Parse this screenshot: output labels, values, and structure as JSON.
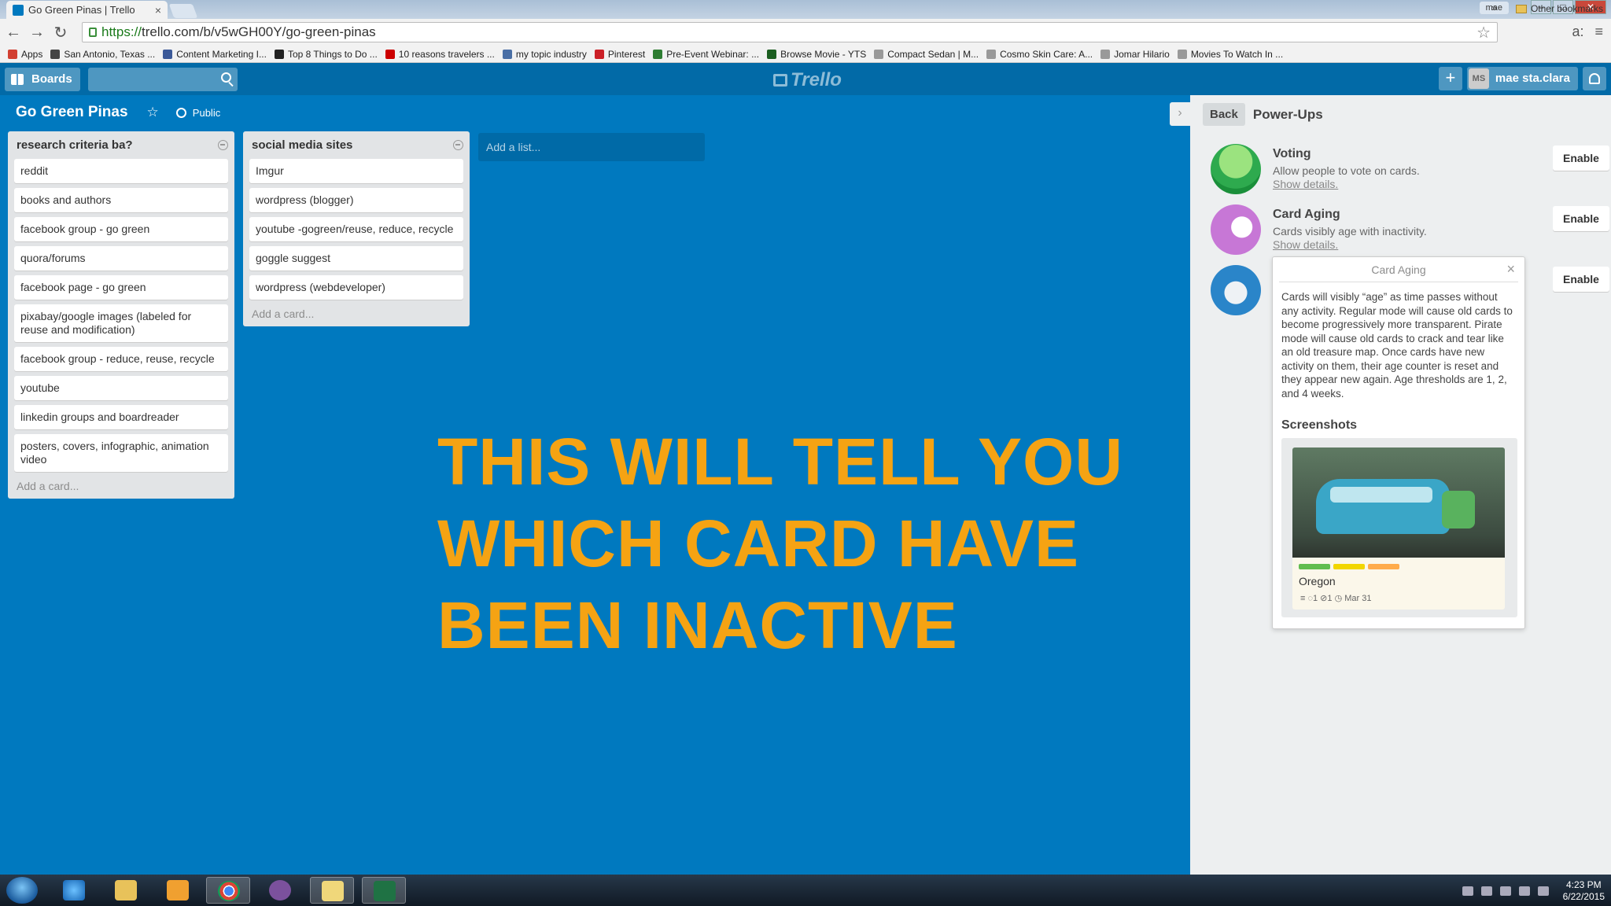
{
  "browser": {
    "tab_title": "Go Green Pinas | Trello",
    "tab_close": "×",
    "window_user": "mae",
    "url_https": "https://",
    "url_path": "trello.com/b/v5wGH00Y/go-green-pinas",
    "bookmarks": [
      {
        "label": "Apps",
        "color": "#d23f31"
      },
      {
        "label": "San Antonio, Texas ...",
        "color": "#444444"
      },
      {
        "label": "Content Marketing I...",
        "color": "#3b5998"
      },
      {
        "label": "Top 8 Things to Do ...",
        "color": "#222222"
      },
      {
        "label": "10 reasons travelers ...",
        "color": "#cc0000"
      },
      {
        "label": "my topic industry",
        "color": "#4a6fa5"
      },
      {
        "label": "Pinterest",
        "color": "#cb2027"
      },
      {
        "label": "Pre-Event Webinar: ...",
        "color": "#2e7d32"
      },
      {
        "label": "Browse Movie - YTS",
        "color": "#1b5e20"
      },
      {
        "label": "Compact Sedan | M...",
        "color": "#999999"
      },
      {
        "label": "Cosmo Skin Care: A...",
        "color": "#999999"
      },
      {
        "label": "Jomar Hilario",
        "color": "#999999"
      },
      {
        "label": "Movies To Watch In ...",
        "color": "#999999"
      }
    ],
    "bookmarks_more": "»",
    "other_bookmarks": "Other bookmarks"
  },
  "header": {
    "boards_label": "Boards",
    "logo_text": "Trello",
    "add_label": "+",
    "user_initials": "MS",
    "user_name": "mae sta.clara"
  },
  "board": {
    "title": "Go Green Pinas",
    "star": "☆",
    "visibility": "Public"
  },
  "lists": [
    {
      "title": "research criteria ba?",
      "cards": [
        "reddit",
        "books and authors",
        "facebook group - go green",
        "quora/forums",
        "facebook page - go green",
        "pixabay/google images (labeled for reuse and modification)",
        "facebook group - reduce, reuse, recycle",
        "youtube",
        "linkedin groups and boardreader",
        "posters, covers, infographic, animation video"
      ],
      "add_card": "Add a card..."
    },
    {
      "title": "social media sites",
      "cards": [
        "Imgur",
        "wordpress (blogger)",
        "youtube -gogreen/reuse, reduce, recycle",
        "goggle suggest",
        "wordpress (webdeveloper)"
      ],
      "add_card": "Add a card..."
    }
  ],
  "add_list": "Add a list...",
  "caption": "THIS WILL TELL YOU WHICH CARD HAVE BEEN INACTIVE",
  "sidebar": {
    "toggle": "›",
    "back": "Back",
    "title": "Power-Ups",
    "powerups": [
      {
        "name": "Voting",
        "desc": "Allow people to vote on cards.",
        "link": "Show details.",
        "button": "Enable"
      },
      {
        "name": "Card Aging",
        "desc": "Cards visibly age with inactivity.",
        "link": "Show details.",
        "button": "Enable"
      },
      {
        "button": "Enable"
      }
    ]
  },
  "popover": {
    "title": "Card Aging",
    "close": "×",
    "body": "Cards will visibly “age” as time passes without any activity. Regular mode will cause old cards to become progressively more transparent. Pirate mode will cause old cards to crack and tear like an old treasure map. Once cards have new activity on them, their age counter is reset and they appear new again. Age thresholds are 1, 2, and 4 weeks.",
    "screenshots_label": "Screenshots",
    "sample_card": {
      "title": "Oregon",
      "badges": "≡  ◌1  ⊘1  ◷ Mar 31",
      "label_colors": [
        "#61bd4f",
        "#f2d600",
        "#ffab4a"
      ]
    }
  },
  "taskbar": {
    "time": "4:23 PM",
    "date": "6/22/2015"
  },
  "colors": {
    "board_bg": "#0079bf",
    "header_bg": "#026aa7",
    "caption": "#f5a313"
  }
}
